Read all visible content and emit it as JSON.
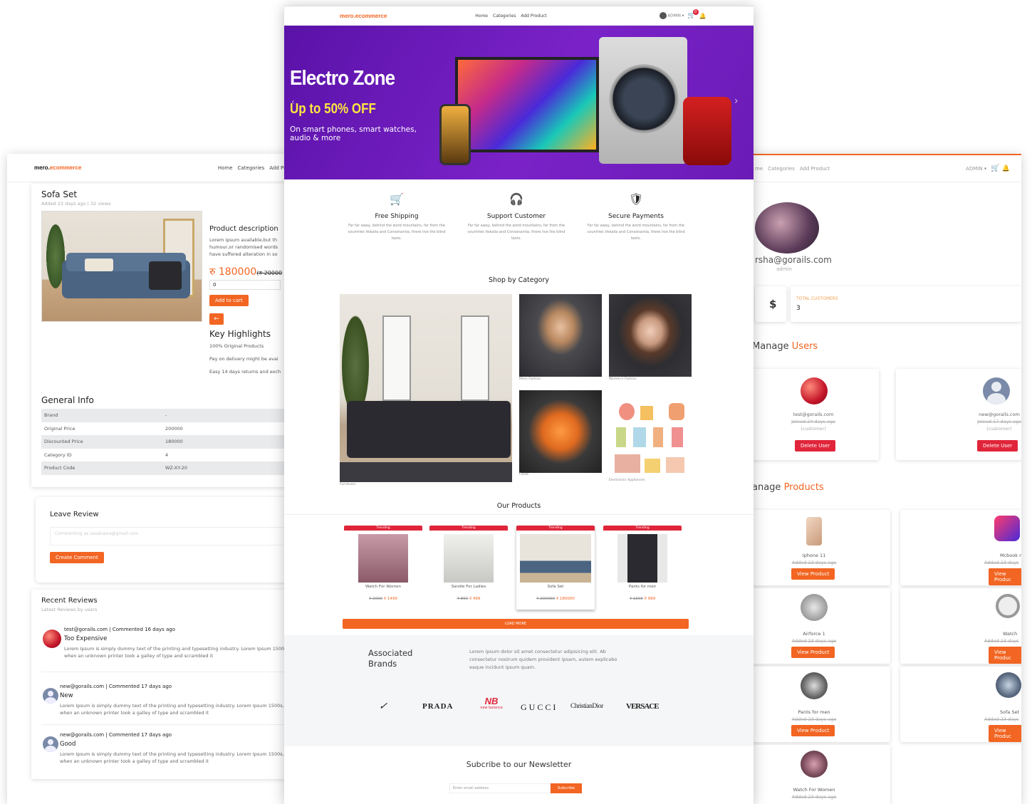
{
  "colors": {
    "accent": "#f26522",
    "red": "#e0253a",
    "banner": "#6a1bb6"
  },
  "nav": {
    "logo_main": "mero.",
    "logo_accent": "ecommerce",
    "links": [
      "Home",
      "Categories",
      "Add Product"
    ],
    "admin_label": "ADMIN",
    "cart_count": "0"
  },
  "left": {
    "nav_links": [
      "Home",
      "Categories",
      "Add Produ"
    ],
    "product_title": "Sofa Set",
    "product_meta": "Added 23 days ago | 32 views",
    "desc_heading": "Product description",
    "desc_text": "Lorem ipsum available,but th humour,or randomised words have suffered alteration in so",
    "price": "रु 180000",
    "old_price": "(रु 20000",
    "qty_value": "0",
    "add_to_cart": "Add to cart",
    "back_icon": "arrow-left-icon",
    "highlights_heading": "Key Highlights",
    "highlights": [
      "100% Original Products",
      "Pay on delivery might be avai",
      "Easy 14 days returns and exch"
    ],
    "general_info_heading": "General Info",
    "info_rows": [
      {
        "label": "Brand",
        "value": "-"
      },
      {
        "label": "Original Price",
        "value": "200000"
      },
      {
        "label": "Discounted Price",
        "value": "180000"
      },
      {
        "label": "Category ID",
        "value": "4"
      },
      {
        "label": "Product Code",
        "value": "WZ-XY-20"
      }
    ],
    "review_heading": "Leave Review",
    "review_placeholder": "Commenting as sasahasra@gmail.com",
    "create_comment": "Create Comment",
    "recent_heading": "Recent Reviews",
    "recent_sub": "Latest Reviews by users",
    "reviews": [
      {
        "meta": "test@gorails.com | Commented 16 days ago",
        "title": "Too Expensive",
        "text": "Lorem Ipsum is simply dummy text of the printing and typesetting industry. Lorem Ipsum 1500s, when an unknown printer took a galley of type and scrambled it"
      },
      {
        "meta": "new@gorails.com | Commented 17 days ago",
        "title": "New",
        "text": "Lorem Ipsum is simply dummy text of the printing and typesetting industry. Lorem Ipsum 1500s, when an unknown printer took a galley of type and scrambled it"
      },
      {
        "meta": "new@gorails.com | Commented 17 days ago",
        "title": "Good",
        "text": "Lorem Ipsum is simply dummy text of the printing and typesetting industry. Lorem Ipsum 1500s, when an unknown printer took a galley of type and scrambled it"
      }
    ]
  },
  "center": {
    "banner_title": "Electro Zone",
    "banner_offer": "Up to 50% OFF",
    "banner_sub": "On smart phones, smart watches, audio & more",
    "features": [
      {
        "icon": "cart-icon",
        "title": "Free Shipping",
        "text": "Far far away, behind the word mountains, far from the countries Vokalia and Consonantia, there live the blind texts."
      },
      {
        "icon": "support-icon",
        "title": "Support Customer",
        "text": "Far far away, behind the word mountains, far from the countries Vokalia and Consonantia, there live the blind texts."
      },
      {
        "icon": "shield-check-icon",
        "title": "Secure Payments",
        "text": "Far far away, behind the word mountains, far from the countries Vokalia and Consonantia, there live the blind texts."
      }
    ],
    "shop_heading": "Shop by Category",
    "categories": [
      "Furnitures",
      "Mens Fashion",
      "Women's Fashion",
      "Foods",
      "Electronics Appliances"
    ],
    "products_heading": "Our Products",
    "badge": "Trending",
    "products": [
      {
        "name": "Watch For Women",
        "old": "रु 2000",
        "price": "रु 1499"
      },
      {
        "name": "Sandle For Ladies",
        "old": "रु 800",
        "price": "रु 499"
      },
      {
        "name": "Sofa Set",
        "old": "रु 200000",
        "price": "रु 180000"
      },
      {
        "name": "Pants for men",
        "old": "रु 1500",
        "price": "रु 999"
      }
    ],
    "load_more": "LOAD MORE",
    "brands_heading": "Associated Brands",
    "brands_text": "Lorem ipsum dolor sit amet consectetur adipisicing elit. Ab consectetur nostrum quidem provident ipsam, autem explicabo eaque incidunt ipsum quam.",
    "brands": [
      "PRADA",
      "new balance",
      "GUCCI",
      "ChristianDior",
      "VERSACE"
    ],
    "newsletter_heading": "Subcribe to our Newsletter",
    "email_placeholder": "Enter email address",
    "subscribe": "Subcribe"
  },
  "right": {
    "nav_links": [
      "me",
      "Categories",
      "Add Product"
    ],
    "admin_label": "ADMIN",
    "email": "rsha@gorails.com",
    "role": "admin",
    "stat_symbol": "$",
    "stat_label": "TOTAL CUSTOMERS",
    "stat_value": "3",
    "manage_users_a": "Manage",
    "manage_users_b": "Users",
    "users": [
      {
        "email": "test@gorails.com",
        "joined": "Joined 24 days ago",
        "role": "(customer)",
        "btn": "Delete User"
      },
      {
        "email": "new@gorails.com",
        "joined": "Joined 17 days ago",
        "role": "(customer)",
        "btn": "Delete User"
      }
    ],
    "manage_products_a": "anage",
    "manage_products_b": "Products",
    "products_left": [
      {
        "name": "Iphone 11",
        "added": "Added 23 days ago",
        "btn": "View Product"
      },
      {
        "name": "Airforce 1",
        "added": "Added 23 days ago",
        "btn": "View Product"
      },
      {
        "name": "Pants for men",
        "added": "Added 23 days ago",
        "btn": "View Product"
      },
      {
        "name": "Watch For Women",
        "added": "Added 23 days ago",
        "btn": "View Product"
      }
    ],
    "products_right": [
      {
        "name": "Mcbook m",
        "added": "Added 23 days",
        "btn": "View Produc"
      },
      {
        "name": "Watch",
        "added": "Added 23 days",
        "btn": "View Produc"
      },
      {
        "name": "Sofa Set",
        "added": "Added 23 days",
        "btn": "View Produc"
      }
    ]
  }
}
